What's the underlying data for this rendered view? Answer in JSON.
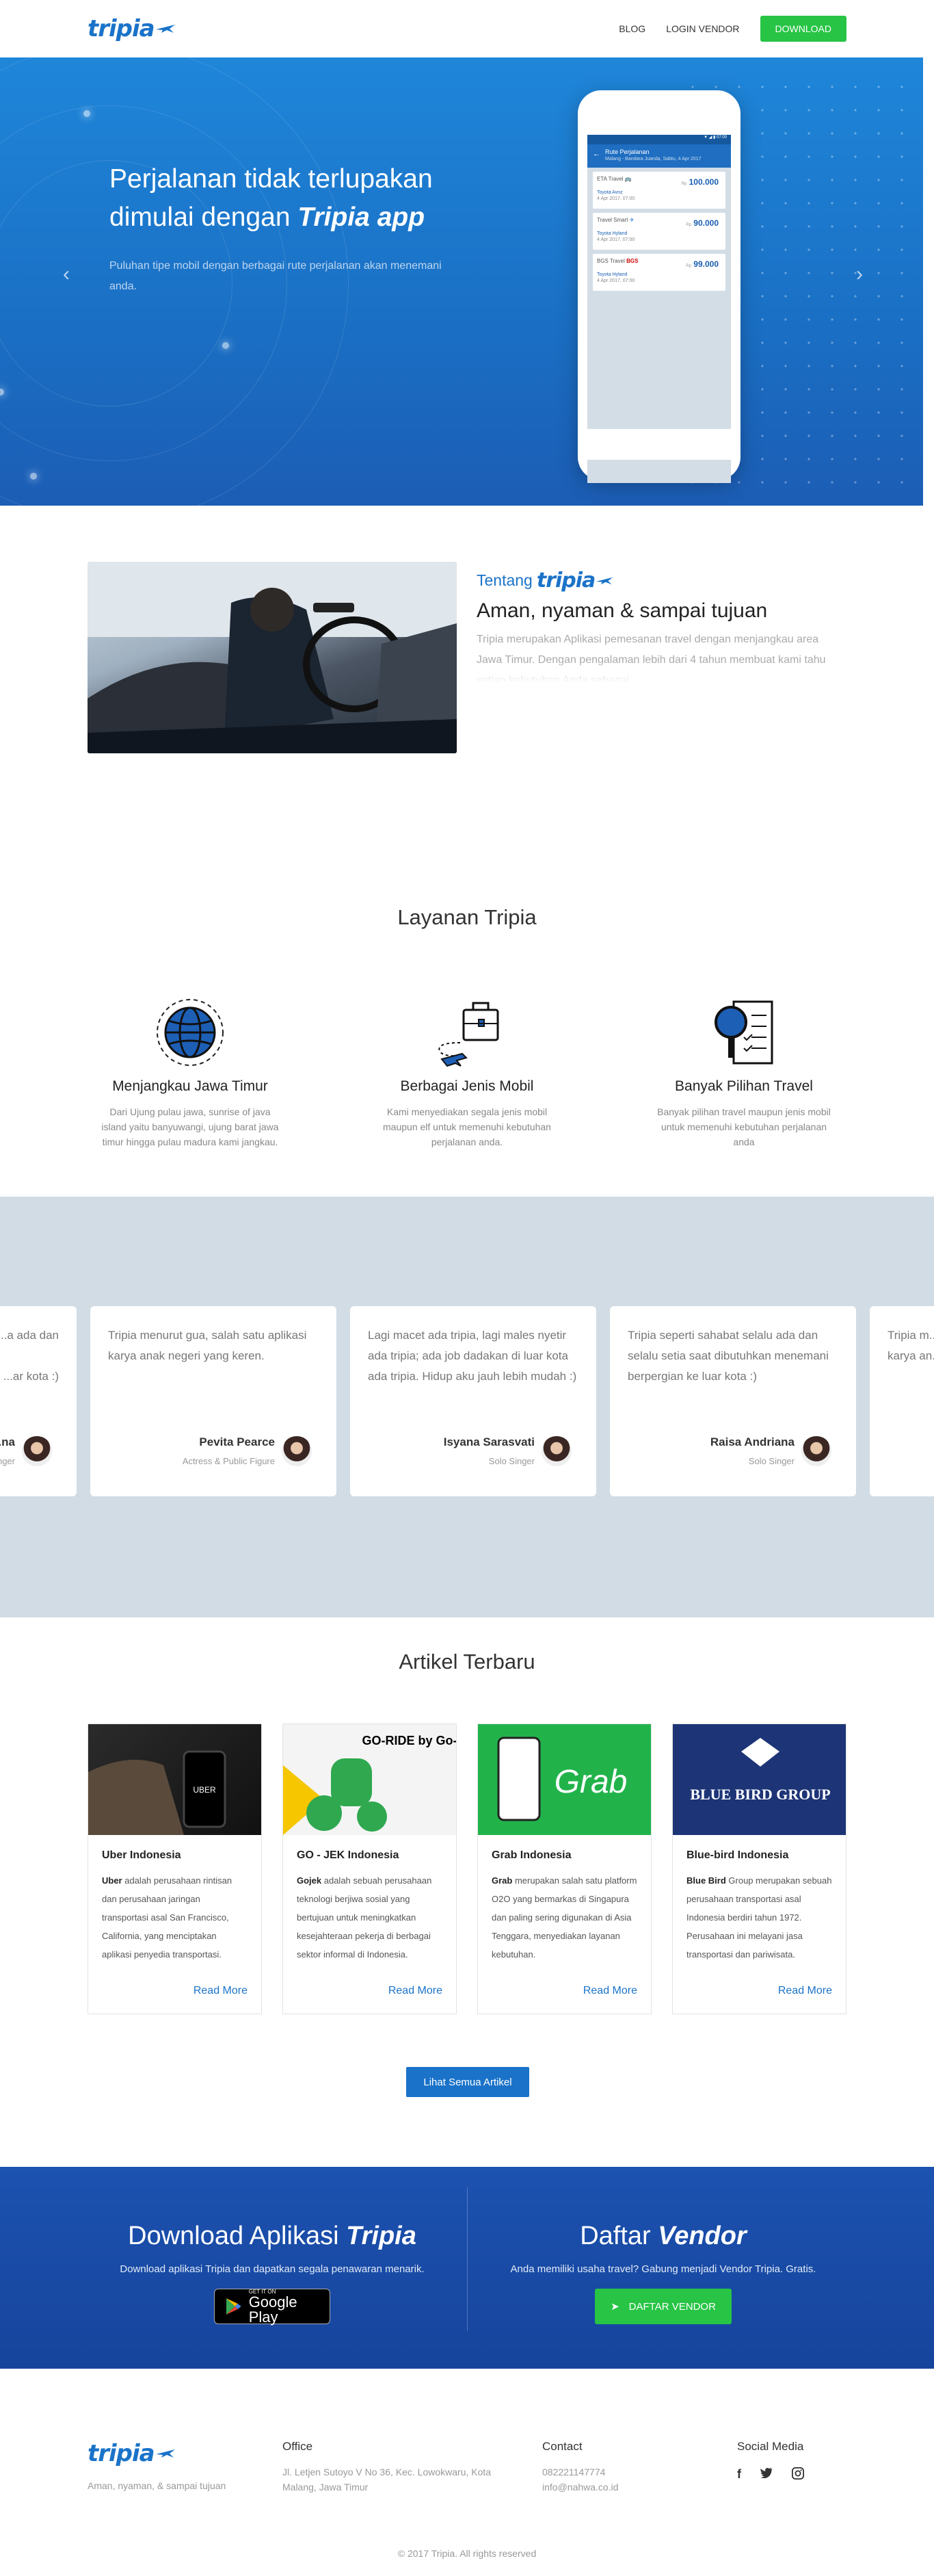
{
  "nav": {
    "logo": "tripia",
    "links": [
      "BLOG",
      "LOGIN VENDOR"
    ],
    "download": "DOWNLOAD"
  },
  "hero": {
    "title_line1": "Perjalanan tidak terlupakan",
    "title_line2_prefix": "dimulai dengan ",
    "title_line2_em": "Tripia app",
    "subtitle": "Puluhan tipe mobil dengan berbagai rute perjalanan akan menemani anda."
  },
  "phone": {
    "status": "▼ ◢ ▮ 07:00",
    "header_title": "Rute Perjalanan",
    "header_sub": "Malang - Bandara Juanda, Sabtu, 4 Apr 2017",
    "cards": [
      {
        "name": "ETA Travel",
        "price_label": "Rp",
        "price": "100.000",
        "link": "Toyota Avnz",
        "date": "4 Apr 2017, 07:00"
      },
      {
        "name": "Travel Smart",
        "price_label": "Rp",
        "price": "90.000",
        "link": "Toyota Hyland",
        "date": "4 Apr 2017, 07:00"
      },
      {
        "name": "BGS Travel",
        "price_label": "Rp",
        "price": "99.000",
        "link": "Toyota Hyland",
        "date": "4 Apr 2017, 07:00"
      }
    ]
  },
  "about": {
    "label": "Tentang",
    "logo": "tripia",
    "title": "Aman, nyaman & sampai tujuan",
    "text": "Tripia merupakan Aplikasi pemesanan travel dengan menjangkau area Jawa Timur. Dengan pengalaman lebih dari 4 tahun membuat kami tahu setiap kebutuhan Anda sebagai"
  },
  "services": {
    "title": "Layanan Tripia",
    "items": [
      {
        "title": "Menjangkau Jawa Timur",
        "text": "Dari Ujung pulau jawa, sunrise of java island yaitu banyuwangi, ujung barat jawa timur hingga pulau madura kami jangkau.",
        "icon": "globe-icon"
      },
      {
        "title": "Berbagai Jenis Mobil",
        "text": "Kami menyediakan segala jenis mobil maupun elf untuk memenuhi kebutuhan perjalanan anda.",
        "icon": "briefcase-plane-icon"
      },
      {
        "title": "Banyak Pilihan Travel",
        "text": "Banyak pilihan travel maupun jenis mobil untuk memenuhi kebutuhan perjalanan anda",
        "icon": "search-checklist-icon"
      }
    ]
  },
  "testimonials": [
    {
      "text": "...a ada dan\n\n...ar kota :)",
      "name": "...na",
      "role": "...nger"
    },
    {
      "text": "Tripia menurut gua, salah satu aplikasi karya anak negeri yang keren.",
      "name": "Pevita Pearce",
      "role": "Actress & Public Figure"
    },
    {
      "text": "Lagi macet ada tripia, lagi males nyetir ada tripia; ada job dadakan di luar kota ada tripia. Hidup aku jauh lebih mudah :)",
      "name": "Isyana Sarasvati",
      "role": "Solo Singer"
    },
    {
      "text": "Tripia seperti sahabat selalu ada dan selalu setia saat dibutuhkan menemani berpergian ke luar kota :)",
      "name": "Raisa Andriana",
      "role": "Solo Singer"
    },
    {
      "text": "Tripia m...\nkarya an...",
      "name": "",
      "role": ""
    }
  ],
  "articles": {
    "title": "Artikel Terbaru",
    "more": "Read More",
    "all": "Lihat Semua Artikel",
    "items": [
      {
        "title": "Uber Indonesia",
        "bold": "Uber",
        "text": " adalah perusahaan rintisan dan perusahaan jaringan transportasi asal San Francisco, California, yang menciptakan aplikasi penyedia transportasi.",
        "img": "UBER"
      },
      {
        "title": "GO - JEK Indonesia",
        "bold": "Gojek",
        "text": " adalah sebuah perusahaan teknologi berjiwa sosial yang bertujuan untuk meningkatkan kesejahteraan pekerja di berbagai sektor informal di Indonesia.",
        "img": "GO-RIDE by Go-Jek"
      },
      {
        "title": "Grab Indonesia",
        "bold": "Grab",
        "text": " merupakan salah satu platform O2O yang bermarkas di Singapura dan paling sering digunakan di Asia Tenggara, menyediakan layanan kebutuhan.",
        "img": "Grab"
      },
      {
        "title": "Blue-bird Indonesia",
        "bold": "Blue Bird",
        "text": " Group merupakan sebuah perusahaan transportasi asal Indonesia berdiri tahun 1972. Perusahaan ini melayani jasa transportasi dan pariwisata.",
        "img": "BLUE BIRD GROUP"
      }
    ]
  },
  "download": {
    "title": "Download Aplikasi ",
    "title_em": "Tripia",
    "text": "Download aplikasi Tripia dan dapatkan segala penawaran menarik.",
    "gp_small": "GET IT ON",
    "gp_big": "Google Play"
  },
  "vendor": {
    "title": "Daftar ",
    "title_em": "Vendor",
    "text": "Anda memiliki usaha travel? Gabung menjadi Vendor Tripia. Gratis.",
    "button": "DAFTAR VENDOR"
  },
  "footer": {
    "logo": "tripia",
    "tagline": "Aman, nyaman, & sampai tujuan",
    "office_title": "Office",
    "office_text": "Jl. Letjen Sutoyo V No 36, Kec. Lowokwaru, Kota Malang, Jawa Timur",
    "contact_title": "Contact",
    "phone": "082221147774",
    "email": "info@nahwa.co.id",
    "social_title": "Social Media",
    "copyright": "© 2017 Tripia. All rights reserved"
  },
  "colors": {
    "primary": "#1a73c9",
    "green": "#27c445",
    "testimonial_bg": "#d1dce4",
    "download_bg": "#1c52b0"
  }
}
